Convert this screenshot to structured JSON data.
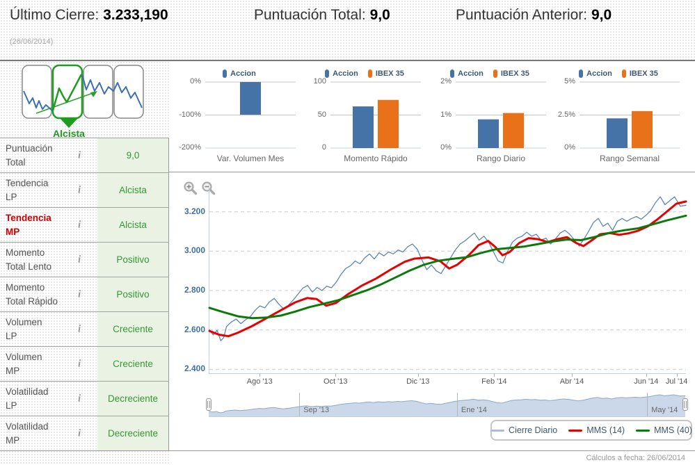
{
  "header": {
    "last_close_label": "Último Cierre:",
    "last_close_value": "3.233,190",
    "score_total_label": "Puntuación Total:",
    "score_total_value": "9,0",
    "score_prev_label": "Puntuación Anterior:",
    "score_prev_value": "9,0",
    "date": "(26/06/2014)"
  },
  "sidebar": {
    "trend_label": "Alcista",
    "info_glyph": "i",
    "rows": [
      {
        "line1": "Puntuación",
        "line2": "Total",
        "value": "9,0",
        "red": false
      },
      {
        "line1": "Tendencia",
        "line2": "LP",
        "value": "Alcista",
        "red": false
      },
      {
        "line1": "Tendencia",
        "line2": "MP",
        "value": "Alcista",
        "red": true
      },
      {
        "line1": "Momento",
        "line2": "Total Lento",
        "value": "Positivo",
        "red": false
      },
      {
        "line1": "Momento",
        "line2": "Total Rápido",
        "value": "Positivo",
        "red": false
      },
      {
        "line1": "Volumen",
        "line2": "LP",
        "value": "Creciente",
        "red": false
      },
      {
        "line1": "Volumen",
        "line2": "MP",
        "value": "Creciente",
        "red": false
      },
      {
        "line1": "Volatilidad",
        "line2": "LP",
        "value": "Decreciente",
        "red": false
      },
      {
        "line1": "Volatilidad",
        "line2": "MP",
        "value": "Decreciente",
        "red": false
      }
    ]
  },
  "chart_data": {
    "mini": [
      {
        "type": "bar",
        "title": "Var. Volumen Mes",
        "ylim": [
          -200,
          0
        ],
        "axis_v": -200,
        "yticks": [
          {
            "v": 0,
            "label": "0%"
          },
          {
            "v": -100,
            "label": "-100%"
          },
          {
            "v": -200,
            "label": "-200%"
          }
        ],
        "series": [
          {
            "name": "Accion",
            "color": "#4572A7",
            "value": -99
          }
        ]
      },
      {
        "type": "bar",
        "title": "Momento Rápido",
        "ylim": [
          0,
          100
        ],
        "axis_v": 0,
        "yticks": [
          {
            "v": 100,
            "label": "100"
          },
          {
            "v": 50,
            "label": "50"
          },
          {
            "v": 0,
            "label": "0"
          }
        ],
        "series": [
          {
            "name": "Accion",
            "color": "#4572A7",
            "value": 63
          },
          {
            "name": "IBEX 35",
            "color": "#E8711A",
            "value": 73
          }
        ]
      },
      {
        "type": "bar",
        "title": "Rango Diario",
        "ylim": [
          0,
          2
        ],
        "axis_v": 0,
        "yticks": [
          {
            "v": 2,
            "label": "2%"
          },
          {
            "v": 1,
            "label": "1%"
          },
          {
            "v": 0,
            "label": "0%"
          }
        ],
        "series": [
          {
            "name": "Accion",
            "color": "#4572A7",
            "value": 0.87
          },
          {
            "name": "IBEX 35",
            "color": "#E8711A",
            "value": 1.06
          }
        ]
      },
      {
        "type": "bar",
        "title": "Rango Semanal",
        "ylim": [
          0,
          5
        ],
        "axis_v": 0,
        "yticks": [
          {
            "v": 5,
            "label": "5%"
          },
          {
            "v": 2.5,
            "label": "2.5%"
          },
          {
            "v": 0,
            "label": "0%"
          }
        ],
        "series": [
          {
            "name": "Accion",
            "color": "#4572A7",
            "value": 2.25
          },
          {
            "name": "IBEX 35",
            "color": "#E8711A",
            "value": 2.8
          }
        ]
      }
    ],
    "main": {
      "type": "line",
      "ylim": [
        2380,
        3340
      ],
      "yticks": [
        {
          "v": 3200,
          "label": "3.200"
        },
        {
          "v": 3000,
          "label": "3.000"
        },
        {
          "v": 2800,
          "label": "2.800"
        },
        {
          "v": 2600,
          "label": "2.600"
        },
        {
          "v": 2400,
          "label": "2.400"
        }
      ],
      "xticks": [
        {
          "x": 0.107,
          "label": "Ago '13"
        },
        {
          "x": 0.266,
          "label": "Oct '13"
        },
        {
          "x": 0.439,
          "label": "Dic '13"
        },
        {
          "x": 0.599,
          "label": "Feb '14"
        },
        {
          "x": 0.762,
          "label": "Abr '14"
        },
        {
          "x": 0.918,
          "label": "Jun '14"
        },
        {
          "x": 0.982,
          "label": "Jul '14"
        }
      ],
      "legend": [
        {
          "label": "Cierre Diario",
          "color": "#A9BFD6"
        },
        {
          "label": "MMS (14)",
          "color": "#E60000"
        },
        {
          "label": "MMS (40)",
          "color": "#0B7A0B"
        }
      ],
      "series": [
        {
          "name": "Cierre Diario",
          "color": "#5F86B5",
          "width": 1.3,
          "points": [
            [
              0,
              2600
            ],
            [
              0.008,
              2575
            ],
            [
              0.016,
              2598
            ],
            [
              0.024,
              2545
            ],
            [
              0.03,
              2562
            ],
            [
              0.036,
              2618
            ],
            [
              0.046,
              2640
            ],
            [
              0.056,
              2655
            ],
            [
              0.066,
              2632
            ],
            [
              0.076,
              2652
            ],
            [
              0.086,
              2668
            ],
            [
              0.096,
              2700
            ],
            [
              0.106,
              2722
            ],
            [
              0.116,
              2712
            ],
            [
              0.126,
              2742
            ],
            [
              0.136,
              2760
            ],
            [
              0.146,
              2730
            ],
            [
              0.156,
              2706
            ],
            [
              0.166,
              2726
            ],
            [
              0.176,
              2752
            ],
            [
              0.186,
              2782
            ],
            [
              0.196,
              2812
            ],
            [
              0.206,
              2826
            ],
            [
              0.216,
              2792
            ],
            [
              0.226,
              2816
            ],
            [
              0.236,
              2800
            ],
            [
              0.246,
              2822
            ],
            [
              0.256,
              2814
            ],
            [
              0.266,
              2842
            ],
            [
              0.276,
              2882
            ],
            [
              0.286,
              2912
            ],
            [
              0.296,
              2926
            ],
            [
              0.306,
              2950
            ],
            [
              0.316,
              2936
            ],
            [
              0.326,
              2966
            ],
            [
              0.336,
              2986
            ],
            [
              0.346,
              2960
            ],
            [
              0.356,
              2992
            ],
            [
              0.366,
              2976
            ],
            [
              0.376,
              2996
            ],
            [
              0.386,
              2986
            ],
            [
              0.396,
              3006
            ],
            [
              0.406,
              2996
            ],
            [
              0.416,
              3022
            ],
            [
              0.426,
              3036
            ],
            [
              0.436,
              3010
            ],
            [
              0.446,
              2955
            ],
            [
              0.456,
              2906
            ],
            [
              0.466,
              2930
            ],
            [
              0.476,
              2900
            ],
            [
              0.486,
              2886
            ],
            [
              0.496,
              2926
            ],
            [
              0.506,
              2966
            ],
            [
              0.516,
              3006
            ],
            [
              0.526,
              3036
            ],
            [
              0.536,
              3052
            ],
            [
              0.546,
              3072
            ],
            [
              0.556,
              3092
            ],
            [
              0.566,
              3056
            ],
            [
              0.576,
              3076
            ],
            [
              0.586,
              3046
            ],
            [
              0.596,
              2996
            ],
            [
              0.606,
              2950
            ],
            [
              0.616,
              2940
            ],
            [
              0.626,
              3000
            ],
            [
              0.636,
              3046
            ],
            [
              0.646,
              3066
            ],
            [
              0.656,
              3076
            ],
            [
              0.666,
              3096
            ],
            [
              0.676,
              3076
            ],
            [
              0.686,
              3086
            ],
            [
              0.696,
              3056
            ],
            [
              0.706,
              3066
            ],
            [
              0.716,
              3036
            ],
            [
              0.726,
              3062
            ],
            [
              0.736,
              3092
            ],
            [
              0.746,
              3106
            ],
            [
              0.756,
              3086
            ],
            [
              0.766,
              3056
            ],
            [
              0.776,
              3026
            ],
            [
              0.786,
              3062
            ],
            [
              0.796,
              3102
            ],
            [
              0.806,
              3146
            ],
            [
              0.816,
              3166
            ],
            [
              0.826,
              3126
            ],
            [
              0.836,
              3142
            ],
            [
              0.846,
              3106
            ],
            [
              0.856,
              3152
            ],
            [
              0.866,
              3166
            ],
            [
              0.876,
              3152
            ],
            [
              0.886,
              3166
            ],
            [
              0.896,
              3176
            ],
            [
              0.906,
              3162
            ],
            [
              0.916,
              3182
            ],
            [
              0.926,
              3206
            ],
            [
              0.936,
              3246
            ],
            [
              0.946,
              3276
            ],
            [
              0.956,
              3236
            ],
            [
              0.966,
              3256
            ],
            [
              0.976,
              3276
            ],
            [
              0.988,
              3228
            ],
            [
              1,
              3233
            ]
          ]
        },
        {
          "name": "MMS (14)",
          "color": "#E60000",
          "width": 3,
          "points": [
            [
              0,
              2595
            ],
            [
              0.02,
              2576
            ],
            [
              0.04,
              2568
            ],
            [
              0.06,
              2586
            ],
            [
              0.09,
              2620
            ],
            [
              0.12,
              2660
            ],
            [
              0.15,
              2700
            ],
            [
              0.18,
              2740
            ],
            [
              0.205,
              2762
            ],
            [
              0.225,
              2757
            ],
            [
              0.245,
              2723
            ],
            [
              0.265,
              2736
            ],
            [
              0.29,
              2780
            ],
            [
              0.32,
              2825
            ],
            [
              0.35,
              2861
            ],
            [
              0.38,
              2906
            ],
            [
              0.41,
              2946
            ],
            [
              0.43,
              2962
            ],
            [
              0.46,
              2968
            ],
            [
              0.485,
              2948
            ],
            [
              0.503,
              2912
            ],
            [
              0.52,
              2931
            ],
            [
              0.545,
              2981
            ],
            [
              0.565,
              3031
            ],
            [
              0.585,
              3052
            ],
            [
              0.6,
              3021
            ],
            [
              0.615,
              2979
            ],
            [
              0.63,
              2996
            ],
            [
              0.65,
              3041
            ],
            [
              0.67,
              3066
            ],
            [
              0.69,
              3061
            ],
            [
              0.71,
              3046
            ],
            [
              0.73,
              3061
            ],
            [
              0.75,
              3071
            ],
            [
              0.77,
              3041
            ],
            [
              0.785,
              3026
            ],
            [
              0.8,
              3051
            ],
            [
              0.82,
              3086
            ],
            [
              0.84,
              3092
            ],
            [
              0.86,
              3083
            ],
            [
              0.88,
              3091
            ],
            [
              0.9,
              3104
            ],
            [
              0.92,
              3126
            ],
            [
              0.94,
              3161
            ],
            [
              0.96,
              3201
            ],
            [
              0.98,
              3241
            ],
            [
              1,
              3252
            ]
          ]
        },
        {
          "name": "MMS (40)",
          "color": "#0B7A0B",
          "width": 3,
          "points": [
            [
              0,
              2712
            ],
            [
              0.03,
              2690
            ],
            [
              0.06,
              2669
            ],
            [
              0.09,
              2660
            ],
            [
              0.12,
              2663
            ],
            [
              0.15,
              2673
            ],
            [
              0.18,
              2693
            ],
            [
              0.21,
              2716
            ],
            [
              0.24,
              2733
            ],
            [
              0.27,
              2751
            ],
            [
              0.3,
              2776
            ],
            [
              0.33,
              2801
            ],
            [
              0.36,
              2831
            ],
            [
              0.39,
              2866
            ],
            [
              0.42,
              2901
            ],
            [
              0.45,
              2931
            ],
            [
              0.48,
              2951
            ],
            [
              0.51,
              2961
            ],
            [
              0.54,
              2969
            ],
            [
              0.57,
              2991
            ],
            [
              0.6,
              3009
            ],
            [
              0.63,
              3016
            ],
            [
              0.66,
              3023
            ],
            [
              0.69,
              3036
            ],
            [
              0.72,
              3049
            ],
            [
              0.75,
              3059
            ],
            [
              0.78,
              3056
            ],
            [
              0.81,
              3073
            ],
            [
              0.84,
              3093
            ],
            [
              0.87,
              3106
            ],
            [
              0.9,
              3116
            ],
            [
              0.93,
              3136
            ],
            [
              0.96,
              3156
            ],
            [
              1,
              3180
            ]
          ]
        }
      ],
      "navigator": {
        "ylim": [
          2400,
          3360
        ],
        "fill": "#CBD8E9",
        "stroke": "#8FA8C4",
        "ticks": [
          {
            "x": 0.19,
            "label": "Sep '13"
          },
          {
            "x": 0.521,
            "label": "Ene '14"
          },
          {
            "x": 0.92,
            "label": "May '14"
          }
        ]
      }
    }
  },
  "footer": {
    "text": "Cálculos a fecha: 26/06/2014"
  }
}
